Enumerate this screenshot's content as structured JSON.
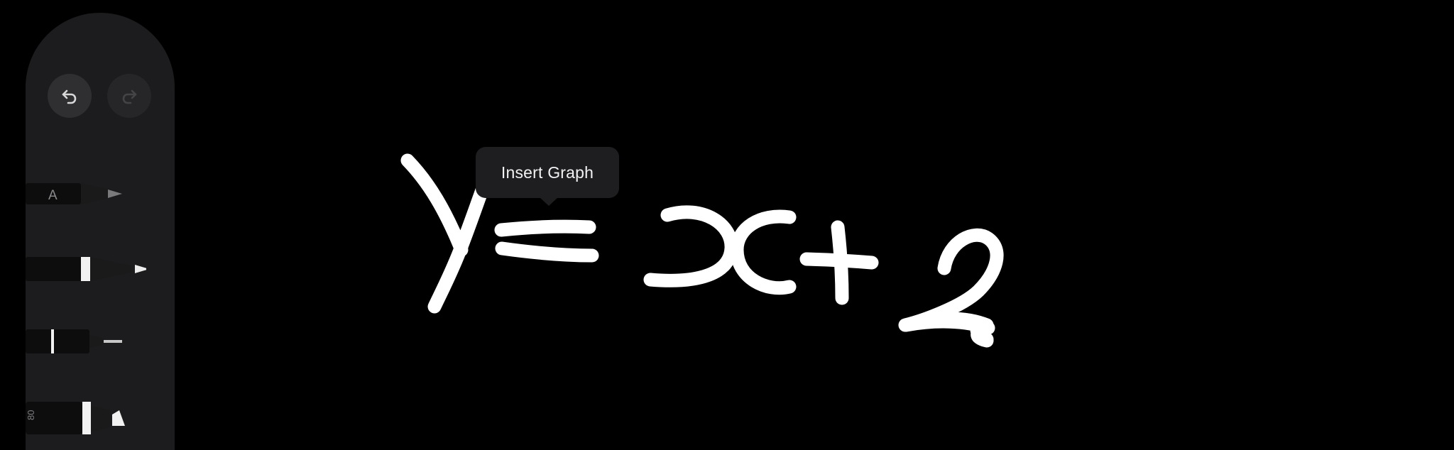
{
  "palette": {
    "undo_icon": "undo-arrow-icon",
    "redo_icon": "redo-arrow-icon",
    "tools": [
      {
        "name": "pencil",
        "label": "A"
      },
      {
        "name": "pen"
      },
      {
        "name": "fineliner"
      },
      {
        "name": "marker",
        "label": "80"
      }
    ]
  },
  "handwriting": {
    "expression": "y=x+2"
  },
  "tooltip": {
    "label": "Insert Graph"
  },
  "colors": {
    "background": "#000000",
    "palette": "#1c1c1e",
    "ink": "#ffffff"
  }
}
